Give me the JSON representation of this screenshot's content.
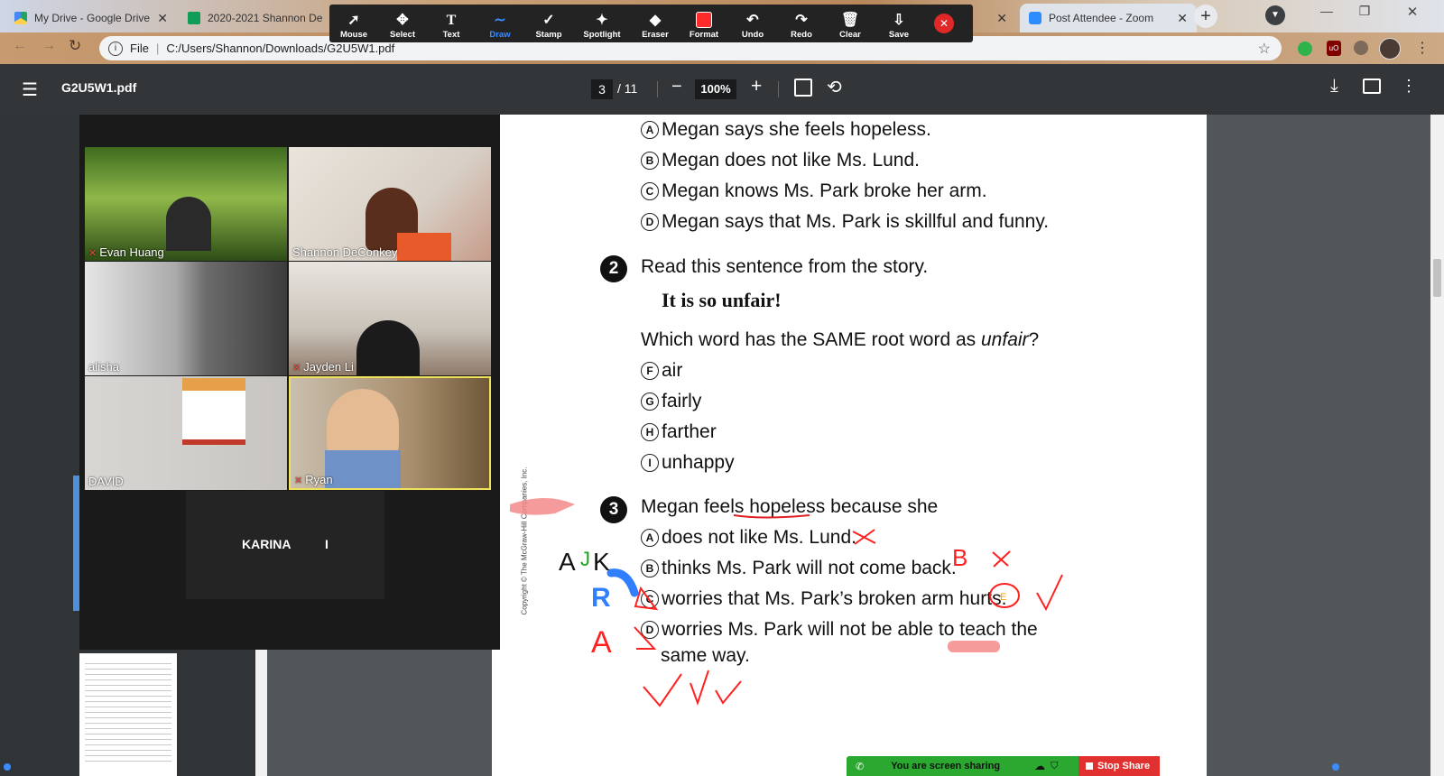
{
  "browser": {
    "tabs": [
      {
        "title": "My Drive - Google Drive"
      },
      {
        "title": "2020-2021 Shannon De"
      },
      {
        "title": "Post Attendee - Zoom"
      }
    ],
    "address": {
      "prefix": "File",
      "url": "C:/Users/Shannon/Downloads/G2U5W1.pdf"
    }
  },
  "zoom_toolbar": {
    "tools": [
      {
        "label": "Mouse",
        "icon": "cursor-icon"
      },
      {
        "label": "Select",
        "icon": "move-icon"
      },
      {
        "label": "Text",
        "icon": "text-icon"
      },
      {
        "label": "Draw",
        "icon": "draw-icon"
      },
      {
        "label": "Stamp",
        "icon": "check-icon"
      },
      {
        "label": "Spotlight",
        "icon": "spotlight-icon"
      },
      {
        "label": "Eraser",
        "icon": "eraser-icon"
      },
      {
        "label": "Format",
        "icon": "format-icon"
      },
      {
        "label": "Undo",
        "icon": "undo-icon"
      },
      {
        "label": "Redo",
        "icon": "redo-icon"
      },
      {
        "label": "Clear",
        "icon": "trash-icon"
      },
      {
        "label": "Save",
        "icon": "save-icon"
      }
    ],
    "active_tool": "Draw",
    "format_color": "#ff2b2b"
  },
  "pdf": {
    "filename": "G2U5W1.pdf",
    "page": "3",
    "total": "/ 11",
    "zoom": "100%"
  },
  "gallery": {
    "participants": [
      {
        "name": "Evan Huang",
        "muted": true
      },
      {
        "name": "Shannon DeConkey",
        "muted": false
      },
      {
        "name": "alisha",
        "muted": false
      },
      {
        "name": "Jayden Li",
        "muted": true
      },
      {
        "name": "DAVID",
        "muted": false
      },
      {
        "name": "Ryan",
        "muted": true
      }
    ],
    "extra_name": "KARINA",
    "extra_suffix": "I"
  },
  "worksheet": {
    "prev_options": [
      {
        "letter": "A",
        "text": "Megan says she feels hopeless."
      },
      {
        "letter": "B",
        "text": "Megan does not like Ms. Lund."
      },
      {
        "letter": "C",
        "text": "Megan knows Ms. Park broke her arm."
      },
      {
        "letter": "D",
        "text": "Megan says that Ms. Park is skillful and funny."
      }
    ],
    "q2": {
      "number": "2",
      "prompt": "Read this sentence from the story.",
      "quote": "It is so unfair!",
      "question_start": "Which word has the SAME root word as ",
      "question_italic": "unfair",
      "question_end": "?",
      "options": [
        {
          "letter": "F",
          "text": "air"
        },
        {
          "letter": "G",
          "text": "fairly"
        },
        {
          "letter": "H",
          "text": "farther"
        },
        {
          "letter": "I",
          "text": "unhappy"
        }
      ]
    },
    "q3": {
      "number": "3",
      "prompt": "Megan feels hopeless because she",
      "options": [
        {
          "letter": "A",
          "text": "does not like Ms. Lund."
        },
        {
          "letter": "B",
          "text": "thinks Ms. Park will not come back."
        },
        {
          "letter": "C",
          "text": "worries that Ms. Park’s broken arm hurts."
        },
        {
          "letter": "D",
          "text": "worries Ms. Park will not be able to teach the"
        }
      ],
      "continuation": "same way."
    },
    "copyright": "Copyright © The McGraw-Hill Companies, Inc."
  },
  "annotations": {
    "letters": [
      "A",
      "J",
      "K",
      "R",
      "B",
      "E",
      "A"
    ],
    "ink_color": "#ff2020",
    "highlight_color": "#f48a8a",
    "blue_ink": "#2f7fff"
  },
  "share_bar": {
    "status": "You are screen sharing",
    "stop_label": "Stop Share",
    "bar_color": "#2aa830",
    "stop_color": "#e0302f"
  }
}
